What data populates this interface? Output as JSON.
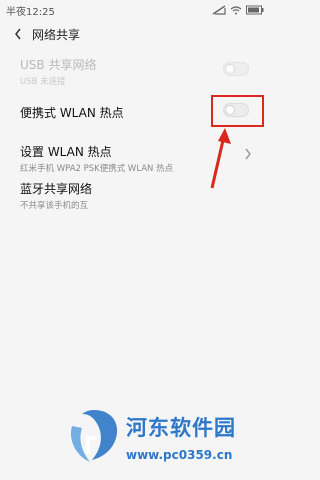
{
  "statusbar": {
    "time": "半夜12:25"
  },
  "header": {
    "title": "网络共享"
  },
  "items": [
    {
      "title": "USB 共享网络",
      "subtitle": "USB 未连接"
    },
    {
      "title": "便携式 WLAN 热点"
    },
    {
      "title": "设置 WLAN 热点",
      "subtitle": "红米手机 WPA2 PSK便携式 WLAN 热点"
    },
    {
      "title": "蓝牙共享网络",
      "subtitle": "不共享该手机的互"
    }
  ],
  "watermark": {
    "name": "河东软件园",
    "url": "www.pc0359.cn"
  },
  "colors": {
    "annotation": "#d8281f",
    "watermark": "#2d78c8"
  }
}
